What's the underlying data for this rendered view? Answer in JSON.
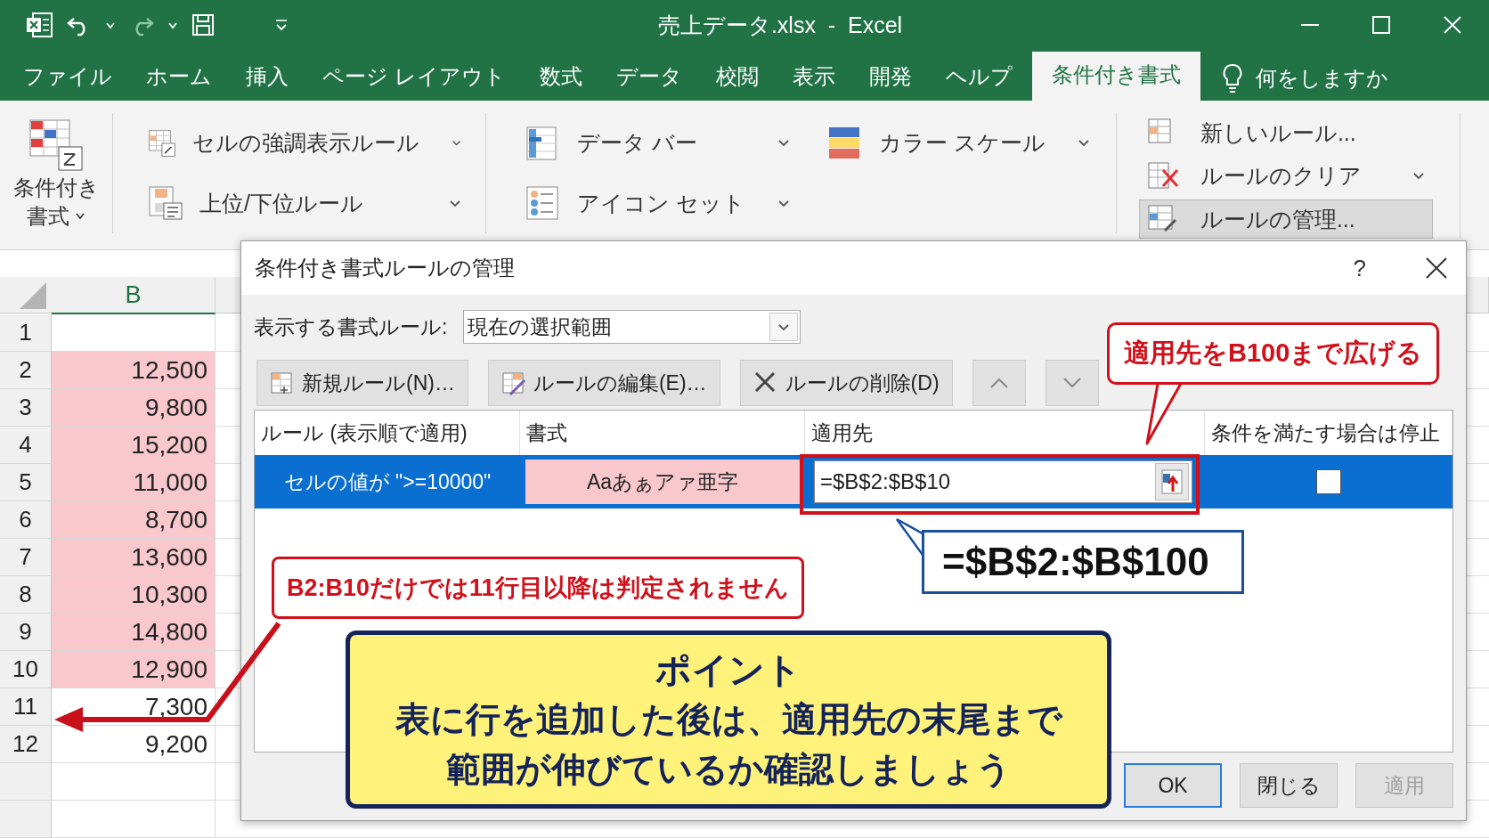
{
  "window": {
    "title": "売上データ.xlsx  -  Excel"
  },
  "ribbon_tabs": [
    {
      "label": "ファイル",
      "selected": false
    },
    {
      "label": "ホーム",
      "selected": false
    },
    {
      "label": "挿入",
      "selected": false
    },
    {
      "label": "ページ レイアウト",
      "selected": false
    },
    {
      "label": "数式",
      "selected": false
    },
    {
      "label": "データ",
      "selected": false
    },
    {
      "label": "校閲",
      "selected": false
    },
    {
      "label": "表示",
      "selected": false
    },
    {
      "label": "開発",
      "selected": false
    },
    {
      "label": "ヘルプ",
      "selected": false
    },
    {
      "label": "条件付き書式",
      "selected": true
    }
  ],
  "tell_me": "何をしますか",
  "ribbon": {
    "groups": [
      {
        "kind": "big",
        "items": [
          {
            "label_lines": [
              "条件付き",
              "書式"
            ],
            "dropdown": true
          }
        ]
      },
      {
        "kind": "stack",
        "items": [
          {
            "label": "セルの強調表示ルール",
            "dropdown": true
          },
          {
            "label": "上位/下位ルール",
            "dropdown": true
          }
        ]
      },
      {
        "kind": "grid",
        "items": [
          {
            "label": "データ バー",
            "dropdown": true
          },
          {
            "label": "カラー スケール",
            "dropdown": true
          },
          {
            "label": "アイコン セット",
            "dropdown": true
          }
        ]
      },
      {
        "kind": "compact",
        "items": [
          {
            "label": "新しいルール...",
            "dropdown": false,
            "highlighted": false
          },
          {
            "label": "ルールのクリア",
            "dropdown": true,
            "highlighted": false
          },
          {
            "label": "ルールの管理...",
            "dropdown": false,
            "highlighted": true
          }
        ]
      }
    ]
  },
  "sheet": {
    "column_header": "B",
    "rows": [
      {
        "number": "1",
        "highlighted": false
      },
      {
        "number": "2",
        "value": "12,500",
        "highlighted": true
      },
      {
        "number": "3",
        "value": "9,800",
        "highlighted": true
      },
      {
        "number": "4",
        "value": "15,200",
        "highlighted": true
      },
      {
        "number": "5",
        "value": "11,000",
        "highlighted": true
      },
      {
        "number": "6",
        "value": "8,700",
        "highlighted": true
      },
      {
        "number": "7",
        "value": "13,600",
        "highlighted": true
      },
      {
        "number": "8",
        "value": "10,300",
        "highlighted": true
      },
      {
        "number": "9",
        "value": "14,800",
        "highlighted": true
      },
      {
        "number": "10",
        "value": "12,900",
        "highlighted": true
      },
      {
        "number": "11",
        "value": "7,300",
        "highlighted": false
      },
      {
        "number": "12",
        "value": "9,200",
        "highlighted": false
      }
    ]
  },
  "dialog": {
    "title": "条件付き書式ルールの管理",
    "help": "?",
    "show_rules": {
      "label": "表示する書式ルール:",
      "value": "現在の選択範囲"
    },
    "toolbar": [
      {
        "label": "新規ルール(N)…"
      },
      {
        "label": "ルールの編集(E)…"
      },
      {
        "label": "ルールの削除(D)"
      }
    ],
    "table": {
      "columns": [
        "ルール (表示順で適用)",
        "書式",
        "適用先",
        "条件を満たす場合は停止"
      ],
      "rows": [
        {
          "rule": "セルの値が \">=10000\"",
          "format_preview": "Aaあぁアァ亜字",
          "applies_to": "=$B$2:$B$10",
          "stop_if_true": false,
          "selected": true
        }
      ]
    },
    "buttons": [
      {
        "label": "OK",
        "default": true,
        "disabled": false
      },
      {
        "label": "閉じる",
        "default": false,
        "disabled": false
      },
      {
        "label": "適用",
        "default": false,
        "disabled": true
      }
    ]
  },
  "annotations": {
    "top_callout": "適用先をB100まで広げる",
    "formula_callout": "=$B$2:$B$100",
    "warning_callout": "B2:B10だけでは11行目以降は判定されません",
    "point": {
      "title": "ポイント",
      "lines": [
        "表に行を追加した後は、適用先の末尾まで",
        "範囲が伸びているか確認しましょう"
      ]
    }
  }
}
